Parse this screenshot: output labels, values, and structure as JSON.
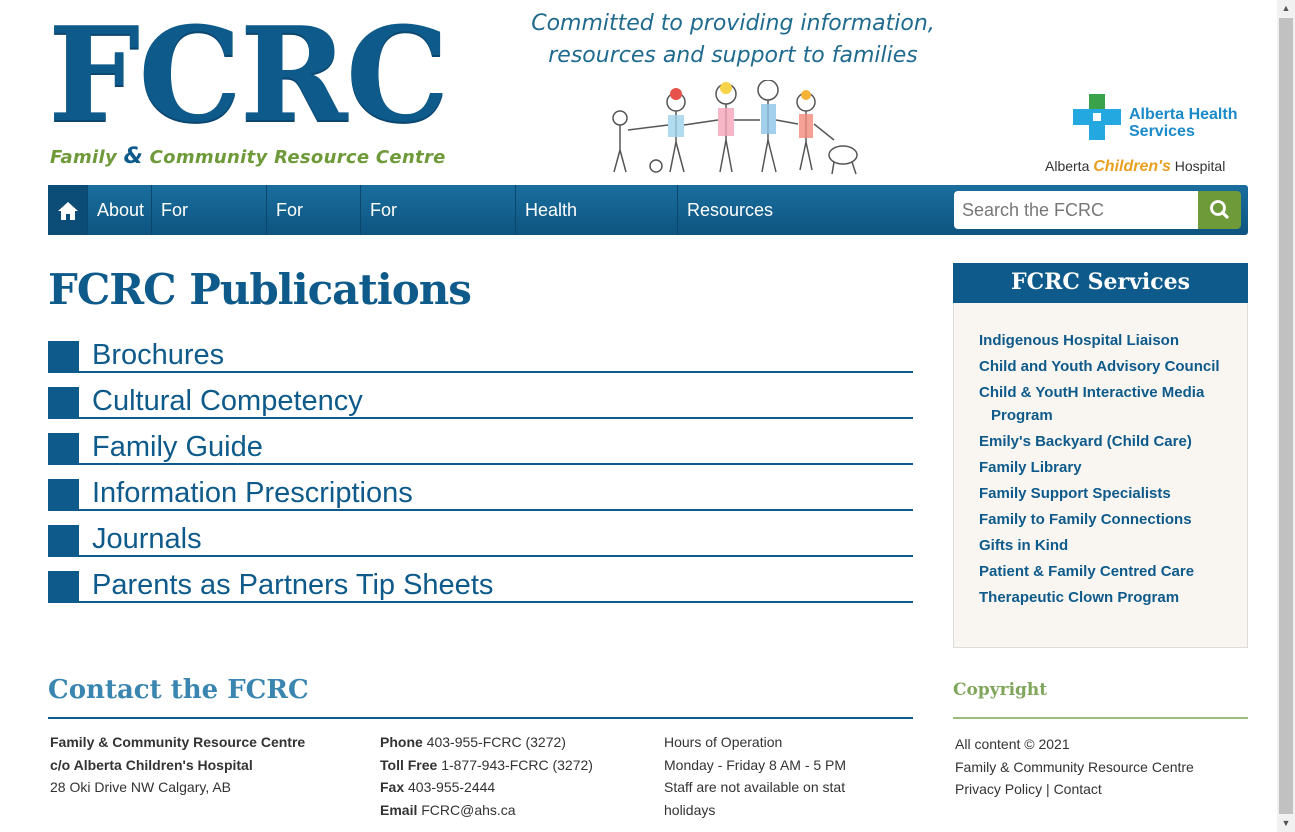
{
  "header": {
    "logo_letters": "FCRC",
    "logo_sub_left": "Family ",
    "logo_sub_amp": "&",
    "logo_sub_right": " Community Resource Centre",
    "tagline_line1": "Committed to providing information,",
    "tagline_line2": "resources and support to families",
    "ahs_line1": "Alberta Health",
    "ahs_line2": "Services",
    "ach_left": "Alberta ",
    "ach_kid": "Children's",
    "ach_right": " Hospital"
  },
  "nav": {
    "items": [
      "About",
      "For Families",
      "For Youth",
      "For Professionals",
      "Health Information",
      "Resources"
    ],
    "search_placeholder": "Search the FCRC"
  },
  "main": {
    "title": "FCRC Publications",
    "publications": [
      "Brochures",
      "Cultural Competency",
      "Family Guide",
      "Information Prescriptions",
      "Journals",
      "Parents as Partners Tip Sheets"
    ]
  },
  "sidebar": {
    "title": "FCRC Services",
    "items": [
      "Indigenous Hospital Liaison",
      "Child and Youth Advisory Council",
      "Child & YoutH Interactive Media Program",
      "Emily's Backyard (Child Care)",
      "Family Library",
      "Family Support Specialists",
      "Family to Family Connections",
      "Gifts in Kind",
      "Patient & Family Centred Care",
      "Therapeutic Clown Program"
    ]
  },
  "footer": {
    "contact_title": "Contact the FCRC",
    "address": {
      "line1": "Family & Community Resource Centre",
      "line2": "c/o Alberta Children's Hospital",
      "line3": "28 Oki Drive NW Calgary, AB"
    },
    "phone": {
      "phone_label": "Phone",
      "phone_value": " 403-955-FCRC (3272)",
      "tollfree_label": "Toll Free",
      "tollfree_value": " 1-877-943-FCRC (3272)",
      "fax_label": "Fax",
      "fax_value": " 403-955-2444",
      "email_label": "Email",
      "email_value": " FCRC@ahs.ca"
    },
    "hours": {
      "line1": "Hours of Operation",
      "line2": "Monday - Friday 8 AM - 5 PM",
      "line3": "Staff are not available on stat",
      "line4": "holidays"
    },
    "copyright_title": "Copyright",
    "copyright": {
      "line1": "All content © 2021",
      "line2": "Family & Community Resource Centre",
      "privacy": "Privacy Policy",
      "sep": " | ",
      "contact": "Contact"
    }
  }
}
